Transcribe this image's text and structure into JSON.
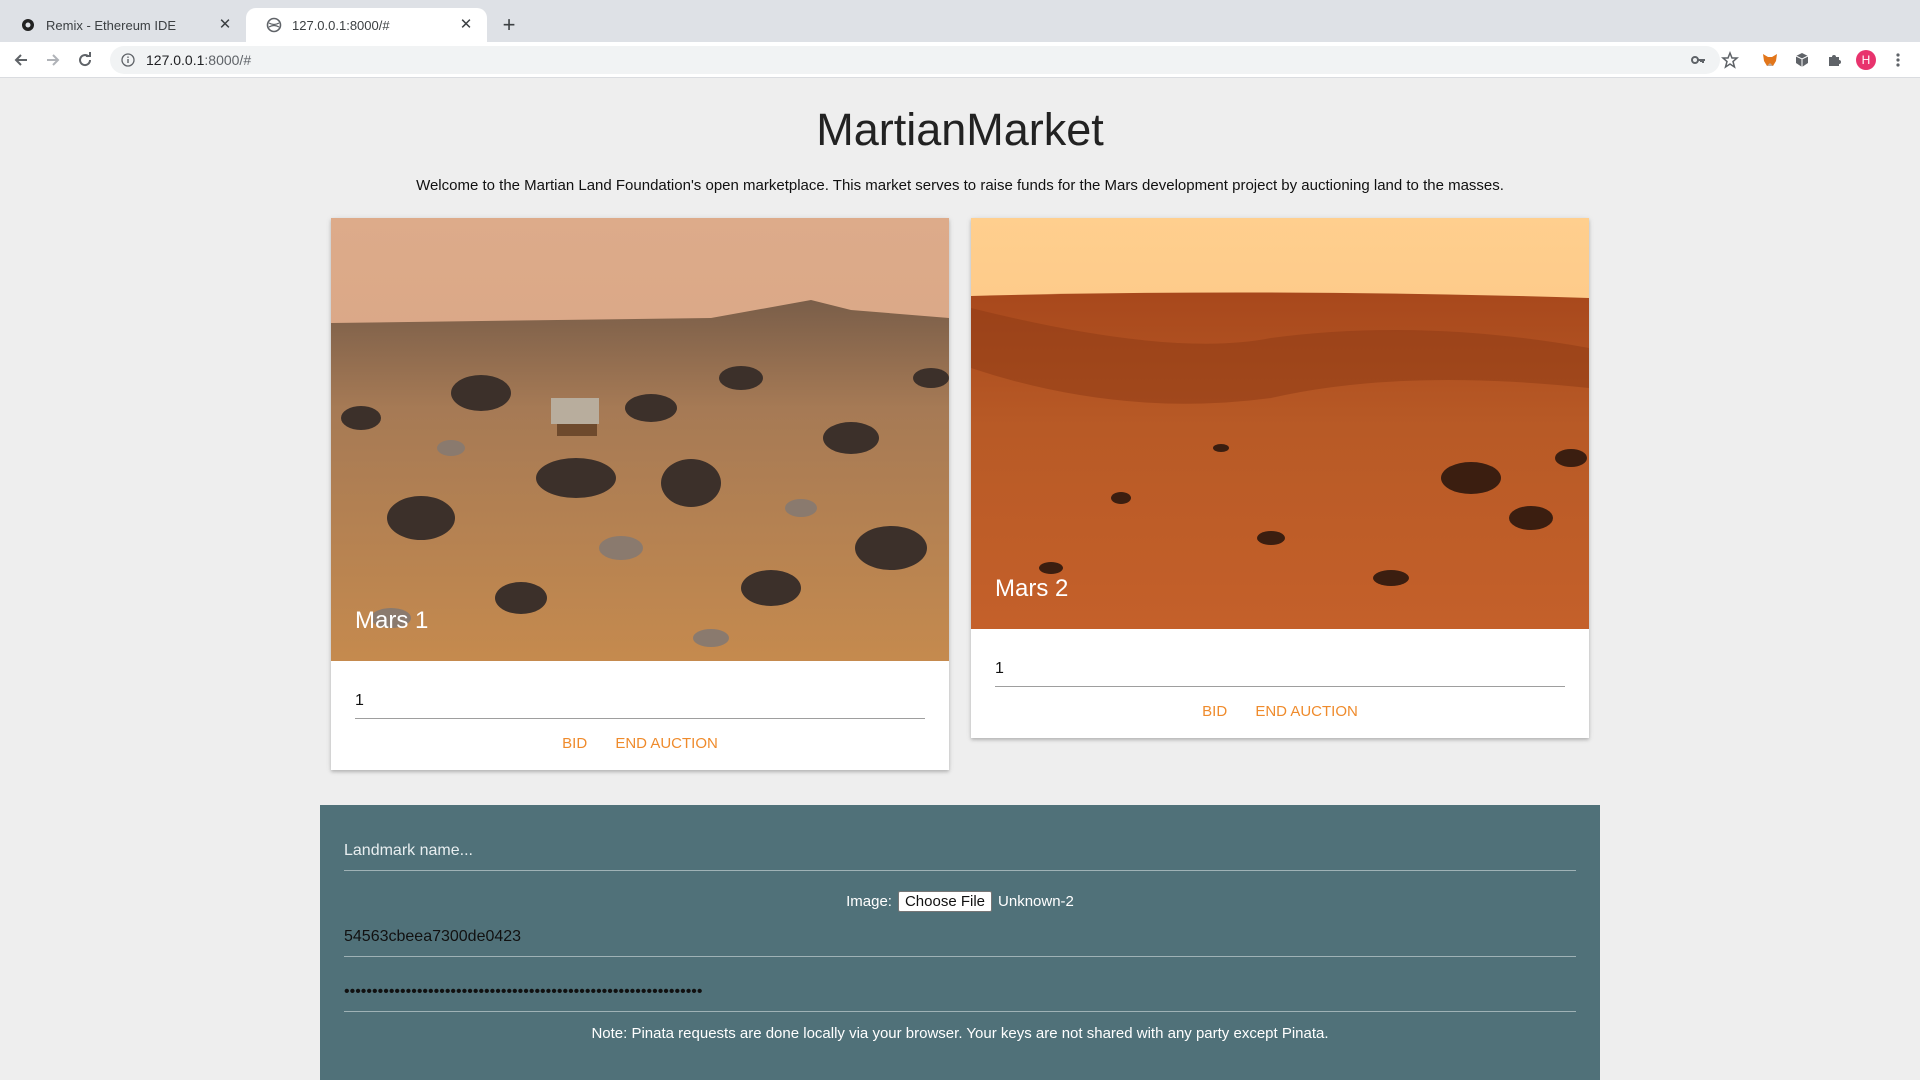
{
  "browser": {
    "tabs": [
      {
        "title": "Remix - Ethereum IDE",
        "active": false,
        "icon": "remix-icon"
      },
      {
        "title": "127.0.0.1:8000/#",
        "active": true,
        "icon": "globe-icon"
      }
    ],
    "url_host": "127.0.0.1",
    "url_rest": ":8000/#",
    "avatar_letter": "H"
  },
  "page": {
    "title": "MartianMarket",
    "intro": "Welcome to the Martian Land Foundation's open marketplace. This market serves to raise funds for the Mars development project by auctioning land to the masses."
  },
  "cards": [
    {
      "name": "Mars 1",
      "bid_value": "1",
      "bid_label": "BID",
      "end_label": "END AUCTION"
    },
    {
      "name": "Mars 2",
      "bid_value": "1",
      "bid_label": "BID",
      "end_label": "END AUCTION"
    }
  ],
  "form": {
    "landmark_placeholder": "Landmark name...",
    "image_label": "Image:",
    "choose_file_label": "Choose File",
    "file_name": "Unknown-2",
    "api_key_value": "54563cbeea7300de0423",
    "secret_value": "••••••••••••••••••••••••••••••••••••••••••••••••••••••••••••••••",
    "note": "Note: Pinata requests are done locally via your browser. Your keys are not shared with any party except Pinata."
  },
  "colors": {
    "accent": "#ef8b2c",
    "panel": "#507179",
    "background": "#eeeeee"
  }
}
